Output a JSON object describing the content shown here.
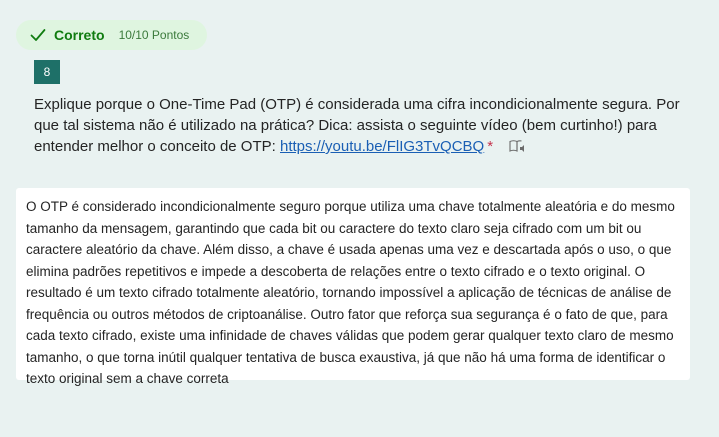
{
  "result": {
    "status_label": "Correto",
    "points": "10/10 Pontos",
    "status_color": "#107c10",
    "badge_color": "#dff5e0",
    "icon": "checkmark-icon"
  },
  "question": {
    "number": "8",
    "text": "Explique porque o One-Time Pad (OTP) é considerada uma cifra incondicionalmente segura. Por que tal sistema não é utilizado na prática? Dica: assista o seguinte vídeo (bem curtinho!) para entender melhor o conceito de OTP: ",
    "link_text": "https://youtu.be/FlIG3TvQCBQ",
    "required_marker": "*",
    "reader_icon": "immersive-reader-icon"
  },
  "answer": {
    "text": "O OTP é considerado incondicionalmente seguro porque utiliza uma chave totalmente aleatória e do mesmo tamanho da mensagem, garantindo que cada bit ou caractere do texto claro seja cifrado com um bit ou caractere aleatório da chave. Além disso, a chave é usada apenas uma vez e descartada após o uso, o que elimina padrões repetitivos e impede a descoberta de relações entre o texto cifrado e o texto original. O resultado é um texto cifrado totalmente aleatório, tornando impossível a aplicação de técnicas de análise de frequência ou outros métodos de criptoanálise. Outro fator que reforça sua segurança é o fato de que, para cada texto cifrado, existe uma infinidade de chaves válidas que podem gerar qualquer texto claro de mesmo tamanho, o que torna inútil qualquer tentativa de busca exaustiva, já que não há uma forma de identificar o texto original sem a chave correta"
  },
  "colors": {
    "background": "#e9f2f1",
    "question_number_bg": "#1e7068",
    "link": "#1a5fb4",
    "required": "#c4314b"
  }
}
